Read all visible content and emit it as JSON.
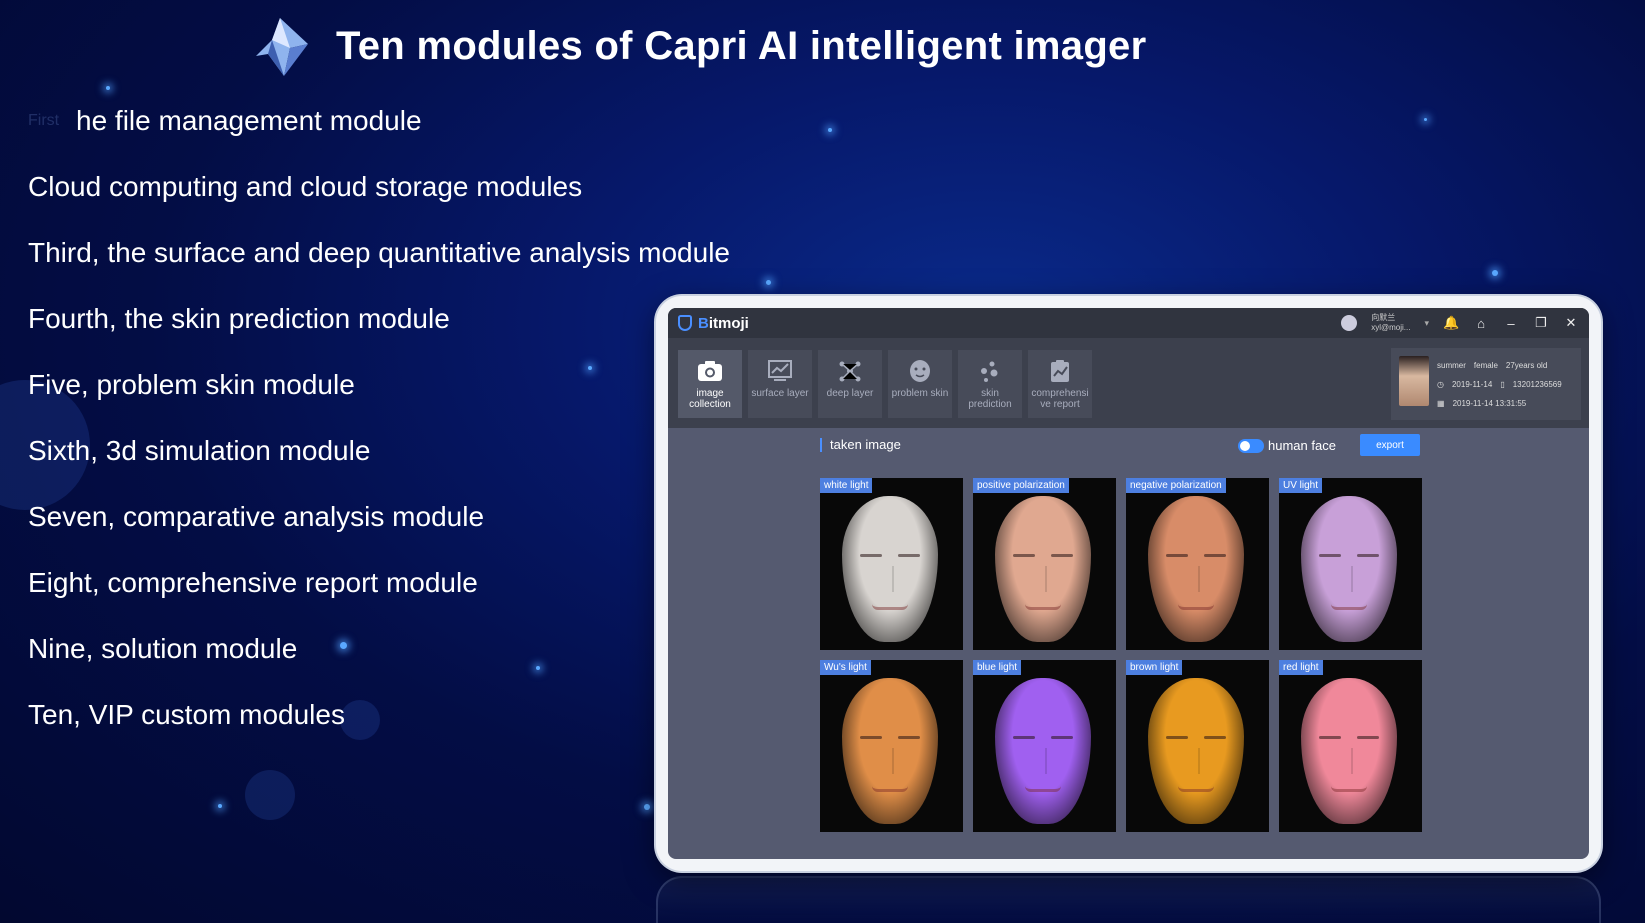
{
  "title": "Ten modules of Capri AI intelligent imager",
  "modules": [
    "he file management module",
    "Cloud computing and cloud storage modules",
    "Third, the surface and deep quantitative analysis module",
    "Fourth, the skin prediction module",
    "Five, problem skin module",
    "Sixth, 3d simulation module",
    "Seven, comparative analysis module",
    "Eight, comprehensive report module",
    "Nine, solution module",
    "Ten, VIP custom modules"
  ],
  "app": {
    "name_b": "B",
    "name_rest": "itmoji",
    "user_name": "向默兰",
    "user_email": "xyl@moji...",
    "toolbar": [
      {
        "label1": "image",
        "label2": "collection",
        "icon": "camera-icon"
      },
      {
        "label1": "surface layer",
        "label2": "",
        "icon": "chart-icon"
      },
      {
        "label1": "deep layer",
        "label2": "",
        "icon": "molecule-icon"
      },
      {
        "label1": "problem skin",
        "label2": "",
        "icon": "face-icon"
      },
      {
        "label1": "skin",
        "label2": "prediction",
        "icon": "dots-icon"
      },
      {
        "label1": "comprehensi",
        "label2": "ve report",
        "icon": "report-icon"
      }
    ],
    "profile": {
      "name": "summer",
      "gender": "female",
      "age": "27years old",
      "date": "2019-11-14",
      "phone": "13201236569",
      "datetime": "2019-11-14 13:31:55"
    },
    "section_title": "taken image",
    "toggle_label": "human face",
    "export_label": "export",
    "images": [
      {
        "label": "white light",
        "color": "#d8d4d0"
      },
      {
        "label": "positive polarization",
        "color": "#e0a890"
      },
      {
        "label": "negative polarization",
        "color": "#d88c68"
      },
      {
        "label": "UV light",
        "color": "#c8a0d8"
      },
      {
        "label": "Wu's light",
        "color": "#e08e48"
      },
      {
        "label": "blue light",
        "color": "#a060f0"
      },
      {
        "label": "brown light",
        "color": "#e89a20"
      },
      {
        "label": "red light",
        "color": "#f0889a"
      }
    ]
  }
}
